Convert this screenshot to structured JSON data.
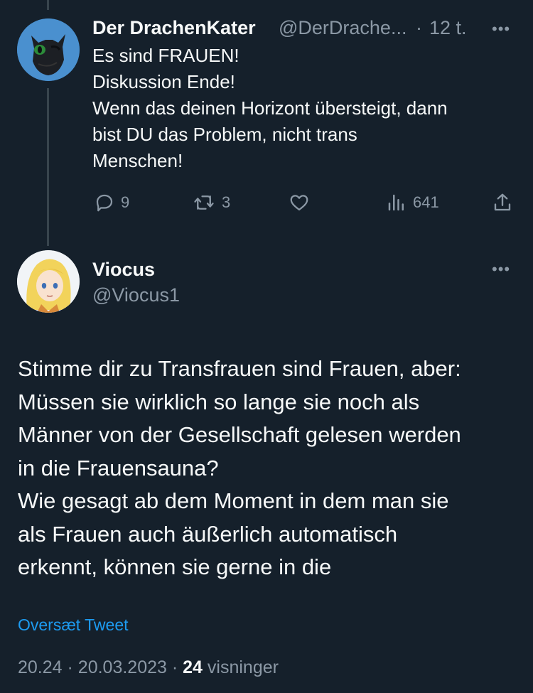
{
  "parent": {
    "name": "Der DrachenKater",
    "handle": "@DerDrache...",
    "dot": "·",
    "time": "12 t.",
    "more": "•••",
    "text": "Es sind FRAUEN!\nDiskussion Ende!\nWenn das deinen Horizont übersteigt, dann\nbist DU das Problem, nicht trans\nMenschen!",
    "actions": {
      "replies": "9",
      "retweets": "3",
      "views": "641",
      "reply_icon": "speech-bubble-icon",
      "retweet_icon": "retweet-icon",
      "like_icon": "heart-icon",
      "views_icon": "bar-chart-icon",
      "share_icon": "share-icon"
    }
  },
  "main": {
    "name": "Viocus",
    "handle": "@Viocus1",
    "more": "•••",
    "text": "Stimme dir zu Transfrauen sind Frauen, aber:\nMüssen sie wirklich so lange sie noch als\nMänner von der Gesellschaft gelesen werden\nin die Frauensauna?\nWie gesagt ab dem Moment in dem man sie\nals Frauen auch äußerlich automatisch\nerkennt, können sie gerne in die",
    "translate": "Oversæt Tweet",
    "time": "20.24",
    "sep1": "·",
    "date": "20.03.2023",
    "sep2": "·",
    "views_count": "24",
    "views_label": "visninger"
  },
  "colors": {
    "background": "#15202b",
    "text": "#f7f9f9",
    "muted": "#8b98a5",
    "link": "#1d9bf0",
    "thread_line": "#38444d"
  }
}
